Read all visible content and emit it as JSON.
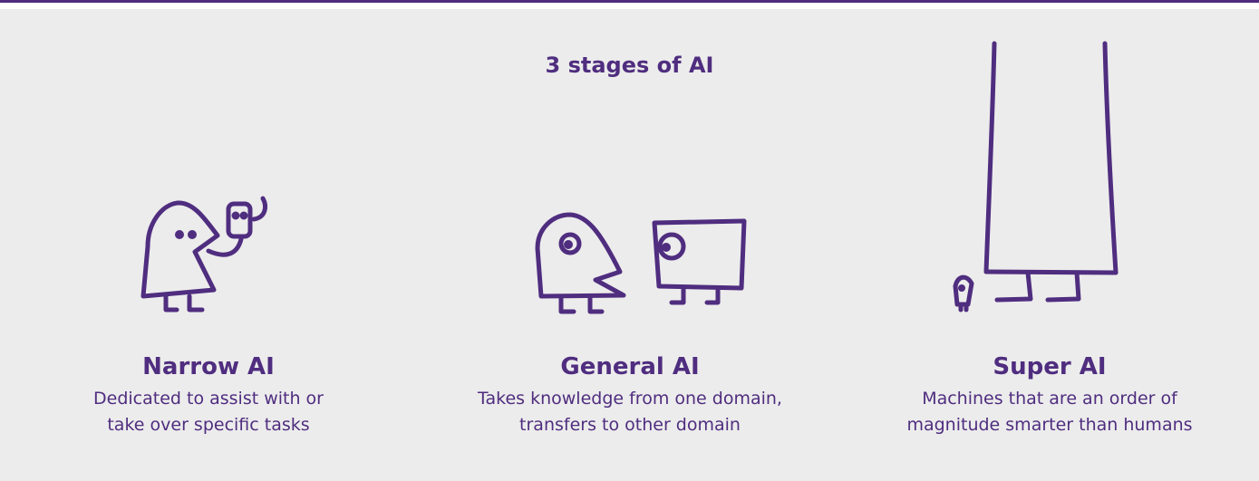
{
  "title": "3 stages of AI",
  "colors": {
    "accent": "#4f2d7f",
    "background": "#ececec"
  },
  "stages": [
    {
      "name": "Narrow AI",
      "description_lines": [
        "Dedicated to assist with or",
        "take over specific tasks"
      ],
      "icon": "small-robot-on-arm-icon"
    },
    {
      "name": "General AI",
      "description_lines": [
        "Takes knowledge from one domain,",
        "transfers to other domain"
      ],
      "icon": "equal-size-robot-icon"
    },
    {
      "name": "Super AI",
      "description_lines": [
        "Machines that are an order of",
        "magnitude smarter than humans"
      ],
      "icon": "giant-robot-icon"
    }
  ]
}
